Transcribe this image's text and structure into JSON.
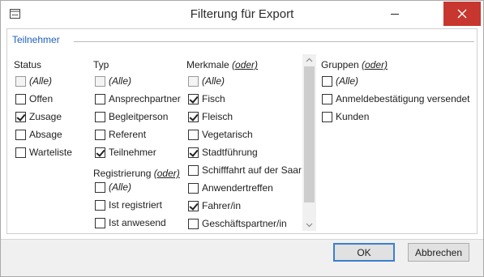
{
  "window": {
    "title": "Filterung für Export"
  },
  "group": {
    "title": "Teilnehmer"
  },
  "status": {
    "header": "Status",
    "items": [
      {
        "label": "(Alle)",
        "checked": false,
        "disabled": true,
        "italic": true
      },
      {
        "label": "Offen",
        "checked": false
      },
      {
        "label": "Zusage",
        "checked": true
      },
      {
        "label": "Absage",
        "checked": false
      },
      {
        "label": "Warteliste",
        "checked": false
      }
    ]
  },
  "typ": {
    "header": "Typ",
    "items": [
      {
        "label": "(Alle)",
        "checked": false,
        "disabled": true,
        "italic": true
      },
      {
        "label": "Ansprechpartner",
        "checked": false
      },
      {
        "label": "Begleitperson",
        "checked": false
      },
      {
        "label": "Referent",
        "checked": false
      },
      {
        "label": "Teilnehmer",
        "checked": true
      }
    ]
  },
  "registrierung": {
    "header": "Registrierung",
    "oder": "(oder)",
    "items": [
      {
        "label": "(Alle)",
        "checked": false,
        "italic": true
      },
      {
        "label": "Ist registriert",
        "checked": false
      },
      {
        "label": "Ist anwesend",
        "checked": false
      }
    ]
  },
  "merkmale": {
    "header": "Merkmale",
    "oder": "(oder)",
    "items": [
      {
        "label": "(Alle)",
        "checked": false,
        "disabled": true,
        "italic": true
      },
      {
        "label": "Fisch",
        "checked": true
      },
      {
        "label": "Fleisch",
        "checked": true
      },
      {
        "label": "Vegetarisch",
        "checked": false
      },
      {
        "label": "Stadtführung",
        "checked": true
      },
      {
        "label": "Schifffahrt auf der Saar",
        "checked": false
      },
      {
        "label": "Anwendertreffen",
        "checked": false
      },
      {
        "label": "Fahrer/in",
        "checked": true
      },
      {
        "label": "Geschäftspartner/in",
        "checked": false
      }
    ]
  },
  "gruppen": {
    "header": "Gruppen",
    "oder": "(oder)",
    "items": [
      {
        "label": "(Alle)",
        "checked": false,
        "italic": true
      },
      {
        "label": "Anmeldebestätigung versendet",
        "checked": false
      },
      {
        "label": "Kunden",
        "checked": false
      }
    ]
  },
  "buttons": {
    "ok": "OK",
    "cancel": "Abbrechen"
  },
  "colors": {
    "group_title": "#1f5fbf",
    "close_button": "#c7372f",
    "default_button_border": "#3c7fd1"
  },
  "icons": {
    "app": "dialog-icon",
    "minimize": "minimize-icon",
    "close": "close-icon",
    "scroll_up": "chevron-up-icon",
    "scroll_down": "chevron-down-icon"
  }
}
